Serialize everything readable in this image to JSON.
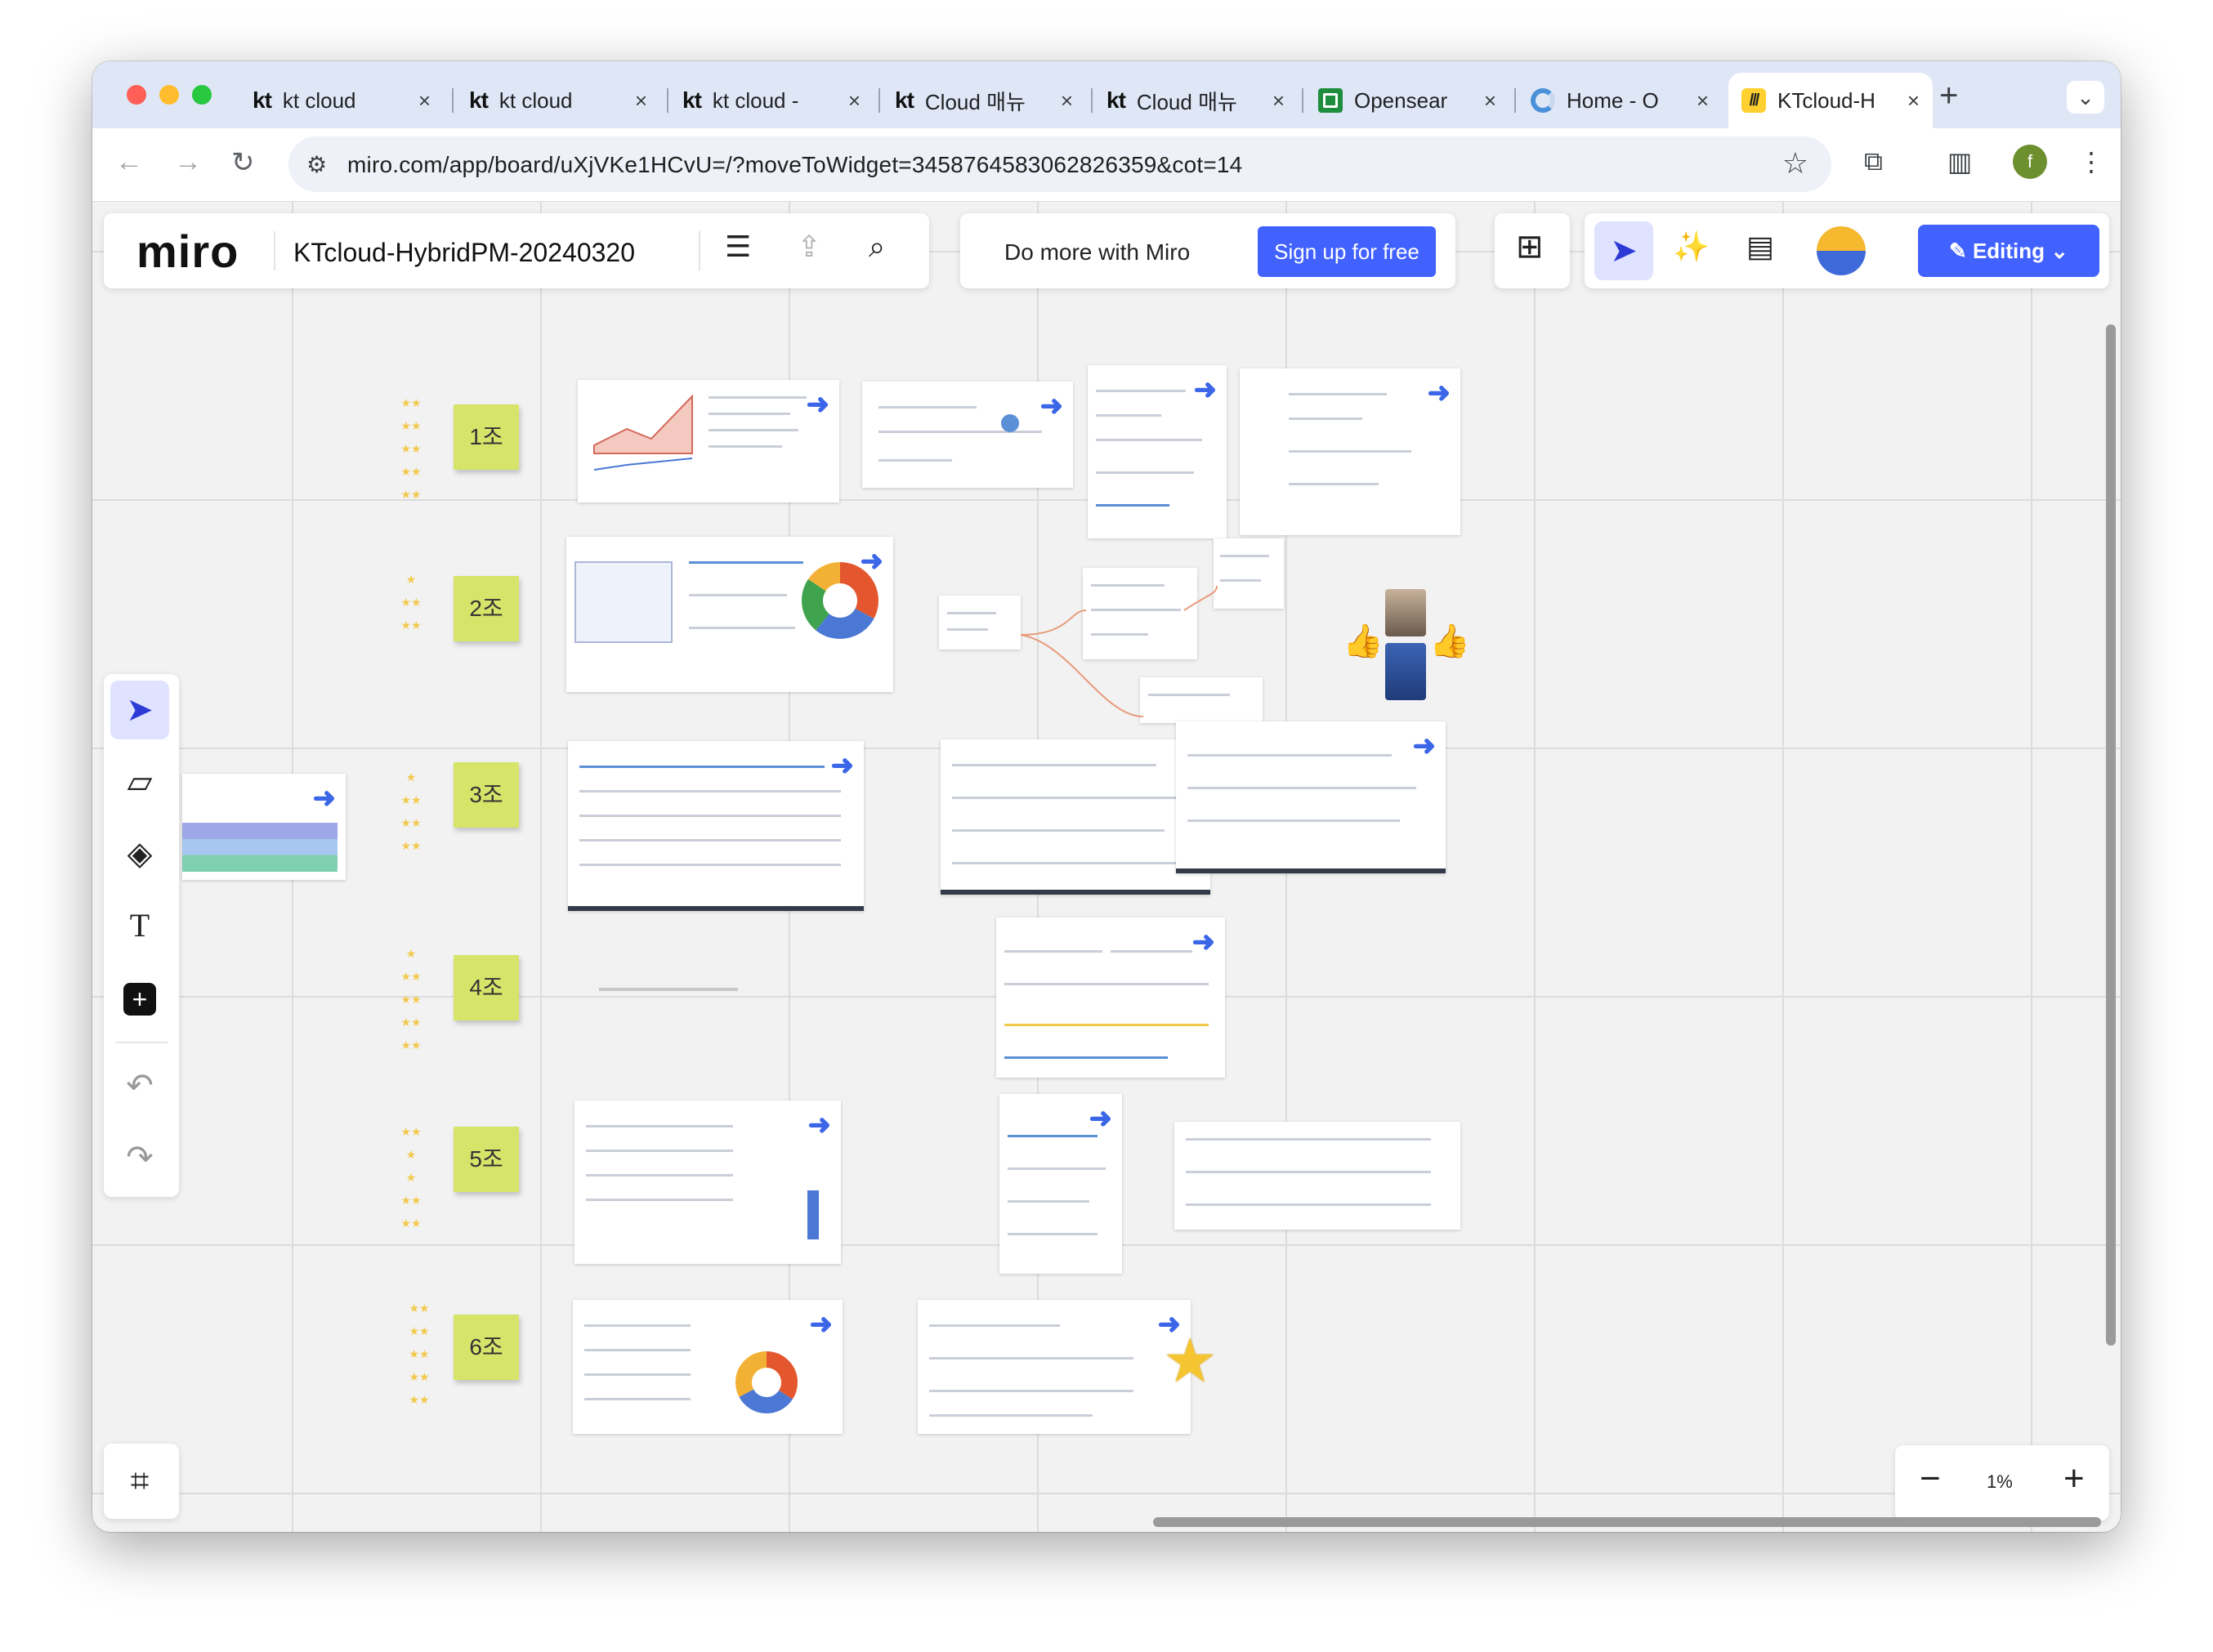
{
  "browser": {
    "tabs": [
      {
        "favicon": "kt",
        "title": "kt cloud"
      },
      {
        "favicon": "kt",
        "title": "kt cloud"
      },
      {
        "favicon": "kt",
        "title": "kt cloud -"
      },
      {
        "favicon": "kt",
        "title": "Cloud 매뉴"
      },
      {
        "favicon": "kt",
        "title": "Cloud 매뉴"
      },
      {
        "favicon": "sheet",
        "title": "Opensear"
      },
      {
        "favicon": "spinner",
        "title": "Home - O"
      },
      {
        "favicon": "miro",
        "title": "KTcloud-H"
      }
    ],
    "close_glyph": "×",
    "new_tab_glyph": "+",
    "tab_menu_glyph": "⌄",
    "url": "miro.com/app/board/uXjVKe1HCvU=/?moveToWidget=3458764583062826359&cot=14",
    "profile_initial": "f",
    "traffic_light_colors": [
      "#ff5f57",
      "#febc2e",
      "#28c840"
    ]
  },
  "miro": {
    "logo": "miro",
    "board_title": "KTcloud-HybridPM-20240320",
    "promo_text": "Do more with Miro",
    "signup_label": "Sign up for free",
    "editing_label": "Editing",
    "accent_color": "#4262ff",
    "zoom_level": "1%",
    "zoom_out_glyph": "−",
    "zoom_in_glyph": "+"
  },
  "board": {
    "groups": [
      "1조",
      "2조",
      "3조",
      "4조",
      "5조",
      "6조"
    ],
    "sticky_color": "#d7e46a"
  }
}
